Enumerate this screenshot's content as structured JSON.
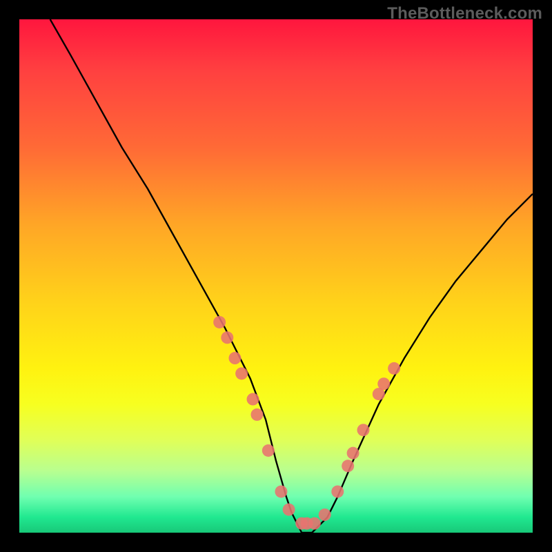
{
  "watermark": "TheBottleneck.com",
  "chart_data": {
    "type": "line",
    "title": "",
    "xlabel": "",
    "ylabel": "",
    "xlim": [
      0,
      100
    ],
    "ylim": [
      0,
      100
    ],
    "legend": "none",
    "grid": false,
    "notch_band_y": [
      0,
      30
    ],
    "series": [
      {
        "name": "curve",
        "color": "#000000",
        "x": [
          6,
          10,
          15,
          20,
          25,
          30,
          35,
          40,
          45,
          48,
          50,
          52,
          53,
          55,
          57,
          60,
          62,
          65,
          70,
          75,
          80,
          85,
          90,
          95,
          100
        ],
        "y": [
          100,
          93,
          84,
          75,
          67,
          58,
          49,
          40,
          30,
          22,
          14,
          7,
          4,
          0,
          0,
          3,
          7,
          14,
          25,
          34,
          42,
          49,
          55,
          61,
          66
        ]
      }
    ],
    "markers": {
      "name": "pink-beads",
      "color": "#e8736f",
      "radius_px": 9,
      "points_xy": [
        [
          39,
          41
        ],
        [
          40.5,
          38
        ],
        [
          42,
          34
        ],
        [
          43.3,
          31
        ],
        [
          45.5,
          26
        ],
        [
          46.3,
          23
        ],
        [
          48.5,
          16
        ],
        [
          51,
          8
        ],
        [
          52.5,
          4.5
        ],
        [
          55,
          1.8
        ],
        [
          56,
          1.8
        ],
        [
          57.5,
          1.8
        ],
        [
          59.5,
          3.5
        ],
        [
          62,
          8
        ],
        [
          64,
          13
        ],
        [
          65,
          15.5
        ],
        [
          67,
          20
        ],
        [
          70,
          27
        ],
        [
          71,
          29
        ],
        [
          73,
          32
        ]
      ]
    }
  }
}
